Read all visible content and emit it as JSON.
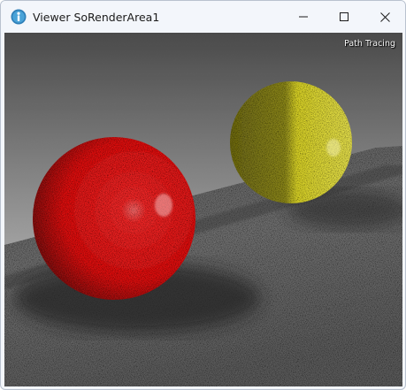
{
  "window": {
    "title": "Viewer SoRenderArea1",
    "app_icon": "info-globe-icon",
    "controls": {
      "minimize": "minimize-icon",
      "maximize": "maximize-icon",
      "close": "close-icon"
    }
  },
  "viewport": {
    "render_mode_label": "Path Tracing",
    "scene": {
      "objects": [
        "red-sphere",
        "yellow-sphere",
        "gray-ground-plane"
      ]
    },
    "colors": {
      "background_top": "#4a4a4a",
      "background_bottom": "#b2b2b2",
      "red_sphere": "#ff1414",
      "yellow_sphere": "#e6df1e",
      "ground": "#6a6a6a"
    }
  }
}
